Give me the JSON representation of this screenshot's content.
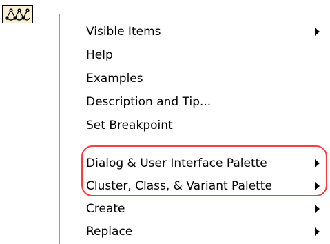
{
  "icons": {
    "node": "node-graph-icon",
    "submenu": "triangle-right-icon"
  },
  "colors": {
    "menu_background": "#ffffff",
    "highlight_ring": "#ff3b3b",
    "node_icon_background": "#f7efcf"
  },
  "menu": {
    "items": [
      {
        "label": "Visible Items",
        "has_submenu": true
      },
      {
        "label": "Help",
        "has_submenu": false
      },
      {
        "label": "Examples",
        "has_submenu": false
      },
      {
        "label": "Description and Tip...",
        "has_submenu": false
      },
      {
        "label": "Set Breakpoint",
        "has_submenu": false
      },
      {
        "label": "Dialog & User Interface Palette",
        "has_submenu": true
      },
      {
        "label": "Cluster, Class, & Variant Palette",
        "has_submenu": true
      },
      {
        "label": "Create",
        "has_submenu": true
      },
      {
        "label": "Replace",
        "has_submenu": true
      }
    ]
  }
}
